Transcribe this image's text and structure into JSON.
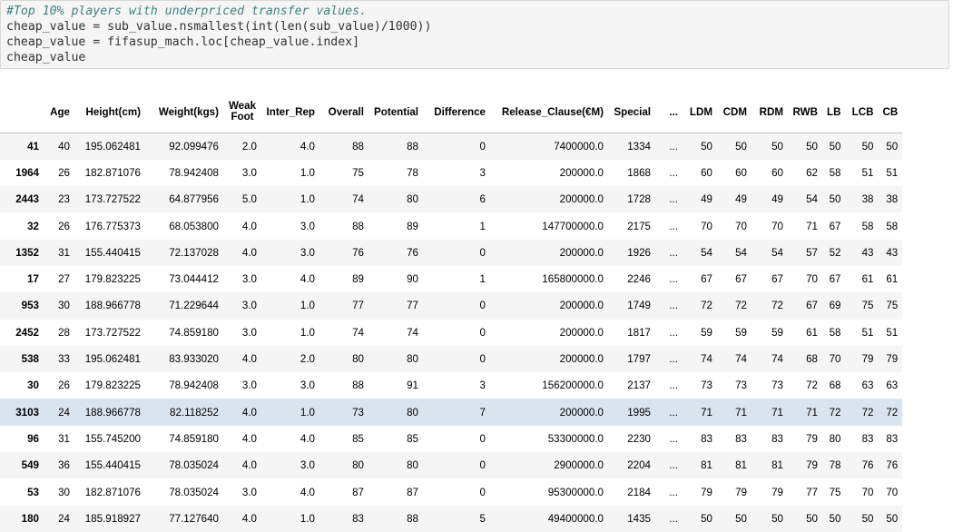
{
  "code": {
    "comment": "#Top 10% players with underpriced transfer values.",
    "line1": "cheap_value = sub_value.nsmallest(int(len(sub_value)/1000))",
    "line2": "cheap_value = fifasup_mach.loc[cheap_value.index]",
    "line3": "cheap_value"
  },
  "table": {
    "columns": [
      "",
      "Age",
      "Height(cm)",
      "Weight(kgs)",
      "Weak Foot",
      "Inter_Rep",
      "Overall",
      "Potential",
      "Difference",
      "Release_Clause(€M)",
      "Special",
      "...",
      "LDM",
      "CDM",
      "RDM",
      "RWB",
      "LB",
      "LCB",
      "CB"
    ],
    "highlighted_index": "3103",
    "rows": [
      [
        "41",
        "40",
        "195.062481",
        "92.099476",
        "2.0",
        "4.0",
        "88",
        "88",
        "0",
        "7400000.0",
        "1334",
        "...",
        "50",
        "50",
        "50",
        "50",
        "50",
        "50",
        "50"
      ],
      [
        "1964",
        "26",
        "182.871076",
        "78.942408",
        "3.0",
        "1.0",
        "75",
        "78",
        "3",
        "200000.0",
        "1868",
        "...",
        "60",
        "60",
        "60",
        "62",
        "58",
        "51",
        "51"
      ],
      [
        "2443",
        "23",
        "173.727522",
        "64.877956",
        "5.0",
        "1.0",
        "74",
        "80",
        "6",
        "200000.0",
        "1728",
        "...",
        "49",
        "49",
        "49",
        "54",
        "50",
        "38",
        "38"
      ],
      [
        "32",
        "26",
        "176.775373",
        "68.053800",
        "4.0",
        "3.0",
        "88",
        "89",
        "1",
        "147700000.0",
        "2175",
        "...",
        "70",
        "70",
        "70",
        "71",
        "67",
        "58",
        "58"
      ],
      [
        "1352",
        "31",
        "155.440415",
        "72.137028",
        "4.0",
        "3.0",
        "76",
        "76",
        "0",
        "200000.0",
        "1926",
        "...",
        "54",
        "54",
        "54",
        "57",
        "52",
        "43",
        "43"
      ],
      [
        "17",
        "27",
        "179.823225",
        "73.044412",
        "3.0",
        "4.0",
        "89",
        "90",
        "1",
        "165800000.0",
        "2246",
        "...",
        "67",
        "67",
        "67",
        "70",
        "67",
        "61",
        "61"
      ],
      [
        "953",
        "30",
        "188.966778",
        "71.229644",
        "3.0",
        "1.0",
        "77",
        "77",
        "0",
        "200000.0",
        "1749",
        "...",
        "72",
        "72",
        "72",
        "67",
        "69",
        "75",
        "75"
      ],
      [
        "2452",
        "28",
        "173.727522",
        "74.859180",
        "3.0",
        "1.0",
        "74",
        "74",
        "0",
        "200000.0",
        "1817",
        "...",
        "59",
        "59",
        "59",
        "61",
        "58",
        "51",
        "51"
      ],
      [
        "538",
        "33",
        "195.062481",
        "83.933020",
        "4.0",
        "2.0",
        "80",
        "80",
        "0",
        "200000.0",
        "1797",
        "...",
        "74",
        "74",
        "74",
        "68",
        "70",
        "79",
        "79"
      ],
      [
        "30",
        "26",
        "179.823225",
        "78.942408",
        "3.0",
        "3.0",
        "88",
        "91",
        "3",
        "156200000.0",
        "2137",
        "...",
        "73",
        "73",
        "73",
        "72",
        "68",
        "63",
        "63"
      ],
      [
        "3103",
        "24",
        "188.966778",
        "82.118252",
        "4.0",
        "1.0",
        "73",
        "80",
        "7",
        "200000.0",
        "1995",
        "...",
        "71",
        "71",
        "71",
        "71",
        "72",
        "72",
        "72"
      ],
      [
        "96",
        "31",
        "155.745200",
        "74.859180",
        "4.0",
        "4.0",
        "85",
        "85",
        "0",
        "53300000.0",
        "2230",
        "...",
        "83",
        "83",
        "83",
        "79",
        "80",
        "83",
        "83"
      ],
      [
        "549",
        "36",
        "155.440415",
        "78.035024",
        "4.0",
        "3.0",
        "80",
        "80",
        "0",
        "2900000.0",
        "2204",
        "...",
        "81",
        "81",
        "81",
        "79",
        "78",
        "76",
        "76"
      ],
      [
        "53",
        "30",
        "182.871076",
        "78.035024",
        "3.0",
        "4.0",
        "87",
        "87",
        "0",
        "95300000.0",
        "2184",
        "...",
        "79",
        "79",
        "79",
        "77",
        "75",
        "70",
        "70"
      ],
      [
        "180",
        "24",
        "185.918927",
        "77.127640",
        "4.0",
        "1.0",
        "83",
        "88",
        "5",
        "49400000.0",
        "1435",
        "...",
        "50",
        "50",
        "50",
        "50",
        "50",
        "50",
        "50"
      ]
    ]
  }
}
